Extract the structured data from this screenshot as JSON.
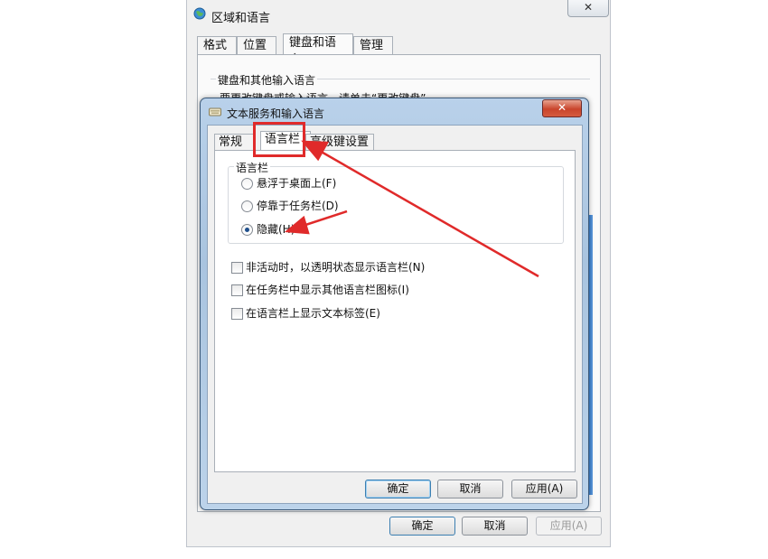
{
  "outer_dialog": {
    "title": "区域和语言",
    "close": "✕",
    "tabs": [
      "格式",
      "位置",
      "键盘和语言",
      "管理"
    ],
    "group_title": "键盘和其他输入语言",
    "group_text": "要更改键盘或输入语言，请单击“更改键盘”",
    "buttons": {
      "ok": "确定",
      "cancel": "取消",
      "apply": "应用(A)"
    }
  },
  "inner_dialog": {
    "title": "文本服务和输入语言",
    "close": "✕",
    "tabs": [
      "常规",
      "语言栏",
      "高级键设置"
    ],
    "language_bar_group": "语言栏",
    "radios": [
      {
        "label": "悬浮于桌面上(F)",
        "checked": false
      },
      {
        "label": "停靠于任务栏(D)",
        "checked": false
      },
      {
        "label": "隐藏(H)",
        "checked": true
      }
    ],
    "checkboxes": [
      {
        "label": "非活动时，以透明状态显示语言栏(N)",
        "checked": false
      },
      {
        "label": "在任务栏中显示其他语言栏图标(I)",
        "checked": false
      },
      {
        "label": "在语言栏上显示文本标签(E)",
        "checked": false
      }
    ],
    "buttons": {
      "ok": "确定",
      "cancel": "取消",
      "apply": "应用(A)"
    }
  },
  "colors": {
    "annotation": "#e02a2a",
    "title_glass": "#b9d1ea",
    "close_red": "#c9452c"
  }
}
